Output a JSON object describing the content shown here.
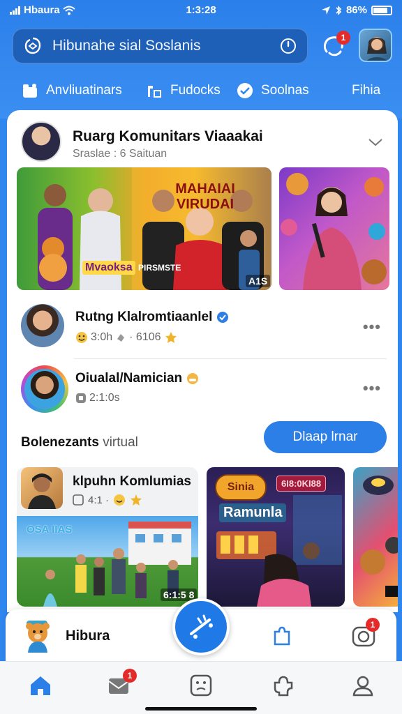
{
  "status_bar": {
    "carrier": "Hbaura",
    "time": "1:3:28",
    "battery": "86%"
  },
  "search": {
    "placeholder": "Hibunahe sial Soslanis"
  },
  "header": {
    "notification_count": "1"
  },
  "nav_tabs": [
    {
      "label": "Anvliuatinars",
      "icon": "gift-icon"
    },
    {
      "label": "Fudocks",
      "icon": "gamepad-icon"
    },
    {
      "label": "Soolnas",
      "icon": "music-icon"
    },
    {
      "label": "Fihia",
      "icon": ""
    }
  ],
  "post": {
    "title": "Ruarg Komunitars Viaaakai",
    "subtitle": "Sraslae : 6 Saituan",
    "banner_text": "MAHAIAI VIRUDAI",
    "banner_caption_left": "Mvaoksa",
    "banner_caption_mid": "PIRSMSTE",
    "banner_caption_right": "A1S"
  },
  "rows": [
    {
      "name": "Rutng Klalromtiaanlel",
      "meta_time": "3:0h",
      "meta_count": "· 6106",
      "verified": true
    },
    {
      "name": "Oiualal/Namician",
      "meta_time": "2:1:0s",
      "meta_count": "",
      "verified": false
    }
  ],
  "section": {
    "title_bold": "Bolenezants",
    "title_light": "virtual",
    "action_label": "Dlaap lrnar"
  },
  "community_card": {
    "title": "klpuhn Komlumias",
    "meta": "4:1 ·",
    "image_caption": "6:1:5 8",
    "sign_text": "OSA IIAS"
  },
  "game_card": {
    "label": "Ramunla",
    "score": "6I8:0KI88",
    "logo": "Sinia"
  },
  "widget_bar": {
    "label": "Hibura",
    "badge_count": "1"
  },
  "tab_bar": {
    "items": [
      "home-icon",
      "inbox-icon",
      "face-icon",
      "puzzle-icon",
      "profile-icon"
    ],
    "inbox_badge": "1"
  },
  "colors": {
    "brand_blue": "#2c7fe6",
    "badge_red": "#e52a2a",
    "header_bg": "#2f86ee"
  }
}
